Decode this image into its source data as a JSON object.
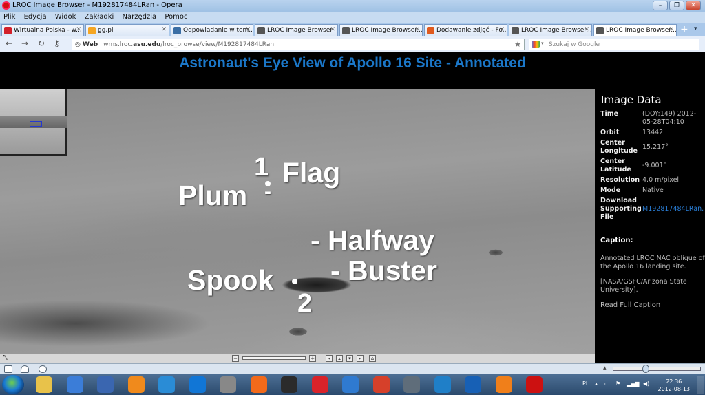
{
  "window": {
    "title": "LROC Image Browser - M192817484LRan - Opera",
    "controls": [
      "–",
      "❐",
      "✕"
    ]
  },
  "menu": [
    "Plik",
    "Edycja",
    "Widok",
    "Zakładki",
    "Narzędzia",
    "Pomoc"
  ],
  "tabs": [
    {
      "label": "Wirtualna Polska - w...",
      "icon_color": "#d2202a",
      "active": false
    },
    {
      "label": "gg.pl",
      "icon_color": "#f5a623",
      "active": false
    },
    {
      "label": "Odpowiadanie w tem...",
      "icon_color": "#3a6ea5",
      "active": false
    },
    {
      "label": "LROC Image Browser",
      "icon_color": "#555555",
      "active": false
    },
    {
      "label": "LROC Image Browser...",
      "icon_color": "#555555",
      "active": false
    },
    {
      "label": "Dodawanie zdjęć - Fo...",
      "icon_color": "#e05a1e",
      "active": false
    },
    {
      "label": "LROC Image Browser...",
      "icon_color": "#555555",
      "active": false
    },
    {
      "label": "LROC Image Browser...",
      "icon_color": "#555555",
      "active": true
    }
  ],
  "nav": {
    "back": "←",
    "forward": "→",
    "reload": "↻",
    "key": "⚷"
  },
  "address": {
    "chip": "Web",
    "prefix": "wms.lroc.",
    "domain": "asu.edu",
    "path": "/lroc_browse/view/M192817484LRan",
    "star": "★"
  },
  "search": {
    "placeholder": "Szukaj w Google"
  },
  "page": {
    "title": "Astronaut's Eye View of Apollo 16 Site - Annotated"
  },
  "annotations": {
    "flag": "Flag",
    "one": "1",
    "plum": "Plum",
    "plum_dash": "-",
    "halfway": "- Halfway",
    "buster": "- Buster",
    "spook": "Spook",
    "two": "2"
  },
  "zoom": {
    "minus": "−",
    "plus": "+",
    "pan": [
      "◂",
      "▴",
      "▾",
      "▸",
      "⌂"
    ]
  },
  "image_data": {
    "heading": "Image Data",
    "rows": [
      {
        "k": "Time",
        "v": "(DOY:149) 2012-05-28T04:10"
      },
      {
        "k": "Orbit",
        "v": "13442"
      },
      {
        "k": "Center Longitude",
        "v": "15.217°"
      },
      {
        "k": "Center Latitude",
        "v": "-9.001°"
      },
      {
        "k": "Resolution",
        "v": "4.0 m/pixel"
      },
      {
        "k": "Mode",
        "v": "Native"
      },
      {
        "k": "Download Supporting File",
        "v": "M192817484LRan."
      }
    ],
    "caption_heading": "Caption:",
    "caption": "Annotated LROC NAC oblique of the Apollo 16 landing site.",
    "credit": "[NASA/GSFC/Arizona State University].",
    "read_full": "Read Full Caption"
  },
  "taskbar": {
    "lang": "PL",
    "time": "22:36",
    "date": "2012-08-13",
    "apps": [
      "explorer-folder",
      "winamp",
      "media-player",
      "ie",
      "bc",
      "mouse",
      "firefox-alt",
      "ea",
      "puzzle",
      "thunderbird",
      "mail",
      "phone",
      "eye",
      "monitor",
      "firefox",
      "opera",
      "chrome"
    ]
  }
}
